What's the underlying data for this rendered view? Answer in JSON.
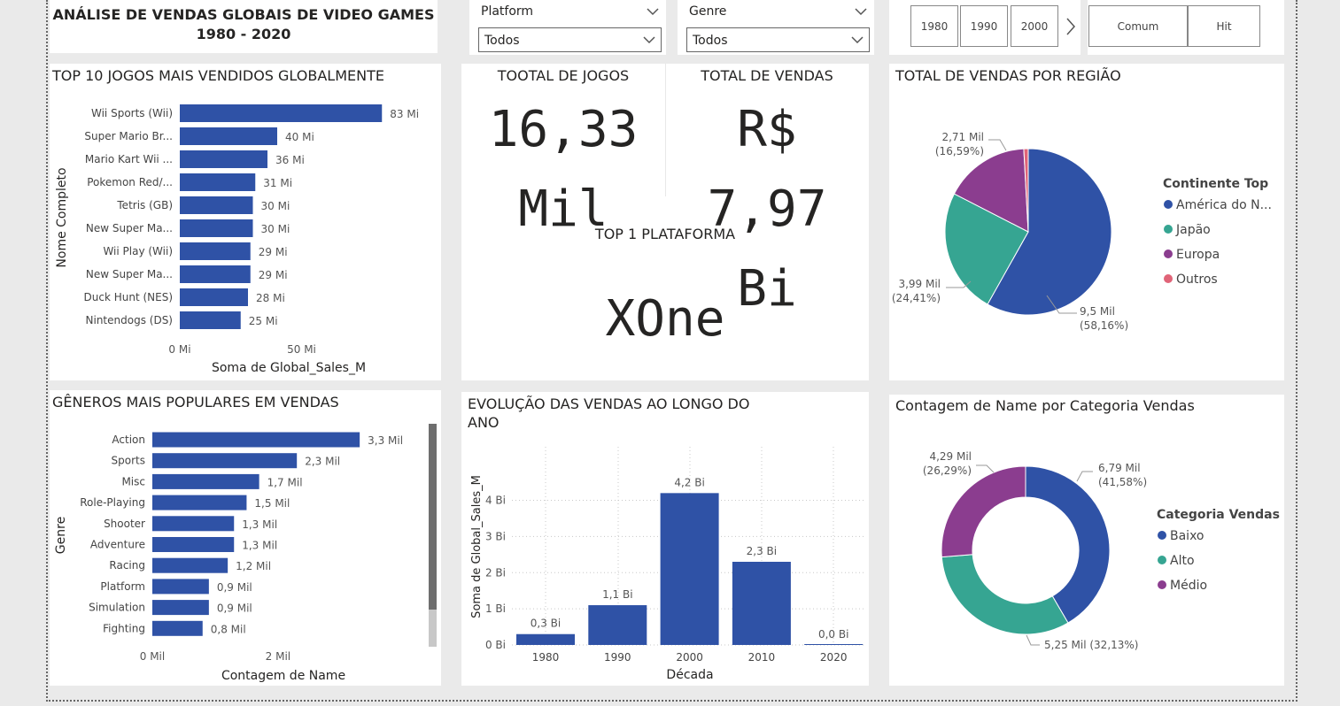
{
  "header": {
    "title_line1": "ANÁLISE DE VENDAS GLOBAIS DE VIDEO GAMES",
    "title_line2": "1980 - 2020"
  },
  "slicers": {
    "platform": {
      "label": "Platform",
      "value": "Todos"
    },
    "genre": {
      "label": "Genre",
      "value": "Todos"
    },
    "decades": [
      "1980",
      "1990",
      "2000"
    ],
    "categories": [
      "Comum",
      "Hit"
    ]
  },
  "colors": {
    "blue": "#2f52a6",
    "teal": "#36a592",
    "purple": "#8b3d8f",
    "pink": "#e06478",
    "card": "#ffffff",
    "bg": "#eaeaea"
  },
  "kpis": {
    "total_jogos": {
      "label": "TOOTAL DE JOGOS",
      "line1": "16,33",
      "line2": "Mil"
    },
    "total_vendas": {
      "label": "TOTAL DE VENDAS",
      "line1": "R$ 7,97",
      "line2": "Bi"
    },
    "top_plataforma": {
      "label": "TOP 1 PLATAFORMA",
      "value": "XOne"
    }
  },
  "chart_data": [
    {
      "id": "top10",
      "type": "bar",
      "orientation": "horizontal",
      "title": "TOP 10 JOGOS MAIS VENDIDOS GLOBALMENTE",
      "xlabel": "Soma de Global_Sales_M",
      "ylabel": "Nome Completo",
      "categories": [
        "Wii Sports (Wii)",
        "Super Mario Br...",
        "Mario Kart Wii ...",
        "Pokemon Red/...",
        "Tetris (GB)",
        "New Super Ma...",
        "Wii Play (Wii)",
        "New Super Ma...",
        "Duck Hunt (NES)",
        "Nintendogs (DS)"
      ],
      "values": [
        83,
        40,
        36,
        31,
        30,
        30,
        29,
        29,
        28,
        25
      ],
      "data_labels": [
        "83 Mi",
        "40 Mi",
        "36 Mi",
        "31 Mi",
        "30 Mi",
        "30 Mi",
        "29 Mi",
        "29 Mi",
        "28 Mi",
        "25 Mi"
      ],
      "ticks": [
        {
          "v": 0,
          "label": "0 Mi"
        },
        {
          "v": 50,
          "label": "50 Mi"
        }
      ],
      "xlim": [
        0,
        100
      ]
    },
    {
      "id": "genres",
      "type": "bar",
      "orientation": "horizontal",
      "title": "GÊNEROS MAIS POPULARES EM VENDAS",
      "xlabel": "Contagem de Name",
      "ylabel": "Genre",
      "categories": [
        "Action",
        "Sports",
        "Misc",
        "Role-Playing",
        "Shooter",
        "Adventure",
        "Racing",
        "Platform",
        "Simulation",
        "Fighting"
      ],
      "values": [
        3.3,
        2.3,
        1.7,
        1.5,
        1.3,
        1.3,
        1.2,
        0.9,
        0.9,
        0.8
      ],
      "data_labels": [
        "3,3 Mil",
        "2,3 Mil",
        "1,7 Mil",
        "1,5 Mil",
        "1,3 Mil",
        "1,3 Mil",
        "1,2 Mil",
        "0,9 Mil",
        "0,9 Mil",
        "0,8 Mil"
      ],
      "ticks": [
        {
          "v": 0,
          "label": "0 Mil"
        },
        {
          "v": 2,
          "label": "2 Mil"
        }
      ],
      "xlim": [
        0,
        4.2
      ]
    },
    {
      "id": "evolution",
      "type": "bar",
      "orientation": "vertical",
      "title": "EVOLUÇÃO DAS VENDAS AO LONGO DO ANO",
      "xlabel": "Década",
      "ylabel": "Soma de Global_Sales_M",
      "categories": [
        "1980",
        "1990",
        "2000",
        "2010",
        "2020"
      ],
      "values": [
        0.3,
        1.1,
        4.2,
        2.3,
        0.0
      ],
      "data_labels": [
        "0,3 Bi",
        "1,1 Bi",
        "4,2 Bi",
        "2,3 Bi",
        "0,0 Bi"
      ],
      "ticks": [
        {
          "v": 0,
          "label": "0 Bi"
        },
        {
          "v": 1,
          "label": "1 Bi"
        },
        {
          "v": 2,
          "label": "2 Bi"
        },
        {
          "v": 3,
          "label": "3 Bi"
        },
        {
          "v": 4,
          "label": "4 Bi"
        }
      ],
      "ylim": [
        0,
        4.6
      ],
      "grid": true
    },
    {
      "id": "regions",
      "type": "pie",
      "title": "TOTAL DE VENDAS POR REGIÃO",
      "legend_title": "Continente Top",
      "legend_position": "right",
      "slices": [
        {
          "name": "América do N...",
          "value": 9.5,
          "color": "#2f52a6",
          "label_value": "9,5 Mil",
          "label_pct": "(58,16%)"
        },
        {
          "name": "Japão",
          "value": 3.99,
          "color": "#36a592",
          "label_value": "3,99 Mil",
          "label_pct": "(24,41%)"
        },
        {
          "name": "Europa",
          "value": 2.71,
          "color": "#8b3d8f",
          "label_value": "2,71 Mil",
          "label_pct": "(16,59%)"
        },
        {
          "name": "Outros",
          "value": 0.14,
          "color": "#e06478",
          "label_value": "",
          "label_pct": ""
        }
      ]
    },
    {
      "id": "categories",
      "type": "pie",
      "subtype": "donut",
      "title": "Contagem de Name por Categoria Vendas",
      "legend_title": "Categoria Vendas",
      "legend_position": "right",
      "slices": [
        {
          "name": "Baixo",
          "value": 6.79,
          "color": "#2f52a6",
          "label_value": "6,79 Mil",
          "label_pct": "(41,58%)"
        },
        {
          "name": "Alto",
          "value": 5.25,
          "color": "#36a592",
          "label_value": "5,25 Mil (32,13%)",
          "label_pct": ""
        },
        {
          "name": "Médio",
          "value": 4.29,
          "color": "#8b3d8f",
          "label_value": "4,29 Mil",
          "label_pct": "(26,29%)"
        }
      ]
    }
  ]
}
